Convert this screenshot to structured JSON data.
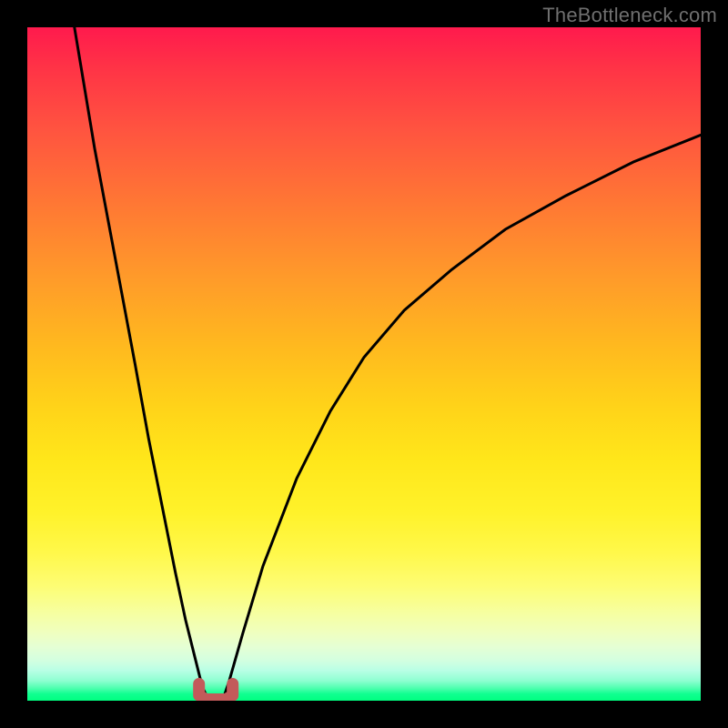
{
  "watermark": "TheBottleneck.com",
  "chart_data": {
    "type": "line",
    "title": "",
    "xlabel": "",
    "ylabel": "",
    "xlim": [
      0,
      100
    ],
    "ylim": [
      0,
      100
    ],
    "background_gradient_meaning": "red (top) = high bottleneck, green (bottom) = no bottleneck",
    "series": [
      {
        "name": "left-branch",
        "x": [
          7,
          10,
          13,
          16,
          18,
          20,
          22,
          23.5,
          25,
          26,
          27
        ],
        "y": [
          100,
          82,
          66,
          50,
          39,
          29,
          19,
          12,
          6,
          2,
          0
        ]
      },
      {
        "name": "right-branch",
        "x": [
          29,
          30,
          32,
          35,
          40,
          45,
          50,
          56,
          63,
          71,
          80,
          90,
          100
        ],
        "y": [
          0,
          3,
          10,
          20,
          33,
          43,
          51,
          58,
          64,
          70,
          75,
          80,
          84
        ]
      },
      {
        "name": "bottom-marker",
        "x": [
          25.5,
          25.5,
          26.5,
          28,
          29.5,
          30.5,
          30.5
        ],
        "y": [
          2.5,
          0.8,
          0.2,
          0.2,
          0.2,
          0.8,
          2.5
        ]
      }
    ],
    "note": "Values are estimates read from an unlabeled plot rendered over a vertical red→green gradient; x and y are expressed as percent of the 740×740 plot area (x left→right, y bottom→top)."
  }
}
